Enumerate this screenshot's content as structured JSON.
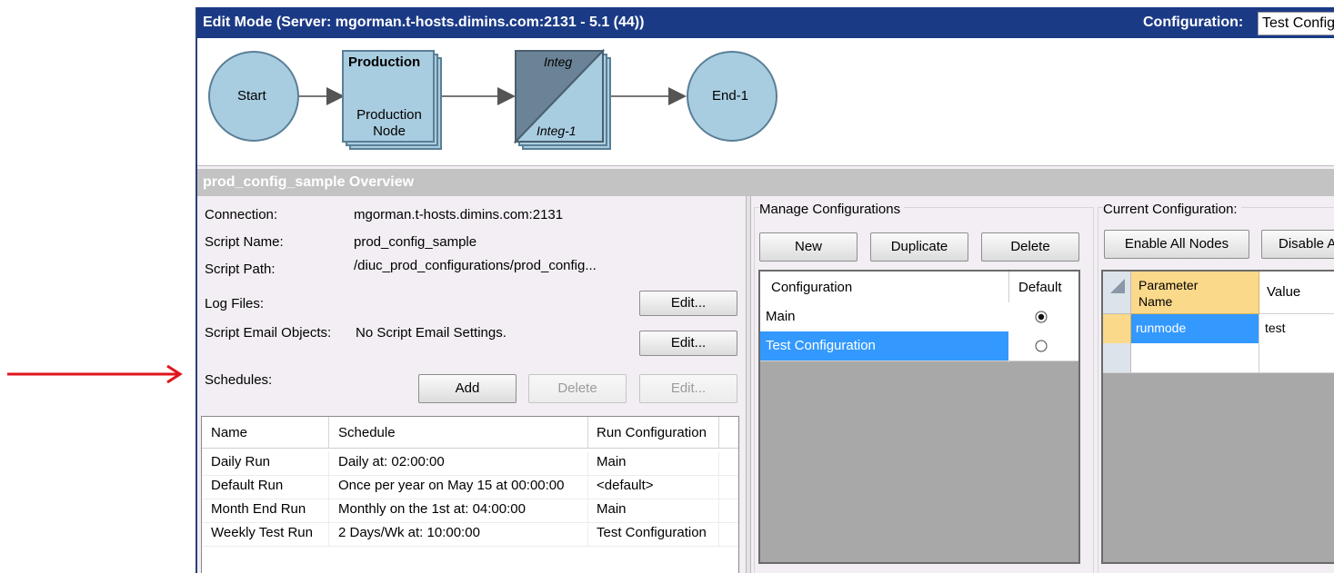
{
  "window": {
    "title": "Edit Mode  (Server: mgorman.t-hosts.dimins.com:2131 - 5.1 (44))",
    "configuration_label": "Configuration:",
    "configuration_value": "Test Configuration"
  },
  "flow": {
    "start": "Start",
    "production_title": "Production",
    "production_label": "Production Node",
    "integ_title": "Integ",
    "integ_label": "Integ-1",
    "end": "End-1"
  },
  "overview": {
    "title": "prod_config_sample Overview",
    "connection_label": "Connection:",
    "connection_value": "mgorman.t-hosts.dimins.com:2131",
    "script_name_label": "Script Name:",
    "script_name_value": "prod_config_sample",
    "script_path_label": "Script Path:",
    "script_path_value": "/diuc_prod_configurations/prod_config...",
    "log_files_label": "Log Files:",
    "log_files_edit": "Edit...",
    "email_label": "Script Email Objects:",
    "email_value": "No Script Email Settings.",
    "email_edit": "Edit...",
    "schedules_label": "Schedules:",
    "add_button": "Add",
    "delete_button": "Delete",
    "edit_button": "Edit..."
  },
  "schedules": {
    "columns": [
      "Name",
      "Schedule",
      "Run Configuration"
    ],
    "rows": [
      [
        "Daily Run",
        "Daily at: 02:00:00",
        "Main"
      ],
      [
        "Default Run",
        "Once per year on May 15 at 00:00:00",
        "<default>"
      ],
      [
        "Month End Run",
        "Monthly on the 1st at: 04:00:00",
        "Main"
      ],
      [
        "Weekly Test Run",
        "2 Days/Wk at: 10:00:00",
        "Test Configuration"
      ]
    ]
  },
  "manage": {
    "title": "Manage Configurations",
    "new_button": "New",
    "duplicate_button": "Duplicate",
    "delete_button": "Delete",
    "columns": [
      "Configuration",
      "Default"
    ],
    "rows": [
      {
        "name": "Main",
        "default": true
      },
      {
        "name": "Test Configuration",
        "default": false,
        "selected": true
      }
    ]
  },
  "current": {
    "title": "Current Configuration:",
    "enable_all_button": "Enable All Nodes",
    "disable_button": "Disable All Nodes",
    "columns": [
      "Parameter Name",
      "Value"
    ],
    "rows": [
      {
        "name": "runmode",
        "value": "test"
      }
    ]
  },
  "colors": {
    "title_bar": "#1b3a86",
    "selection": "#3399ff",
    "node_fill": "#a9cde0",
    "arrow": "#e0141c"
  }
}
